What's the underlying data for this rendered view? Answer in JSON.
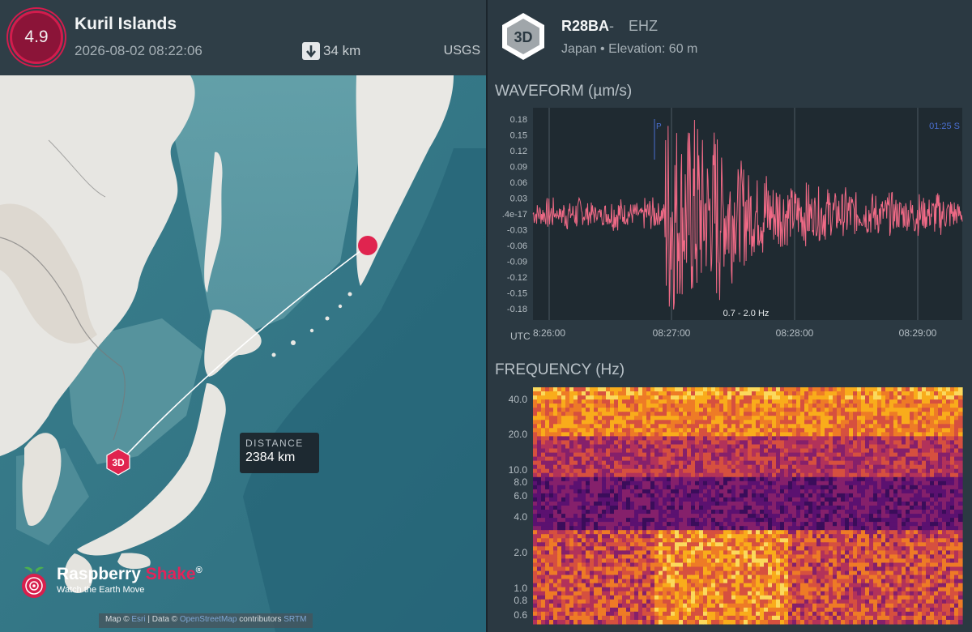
{
  "event": {
    "magnitude": "4.9",
    "title": "Kuril Islands",
    "datetime": "2026-08-02 08:22:06",
    "depth": "34 km",
    "depth_icon": "arrow-down-icon",
    "source": "USGS"
  },
  "map": {
    "distance_label": "DISTANCE",
    "distance_value": "2384 km",
    "station_marker": "3D",
    "epicenter_color": "#e0244f",
    "brand_name_1": "Raspberry ",
    "brand_name_2": "Shake",
    "brand_reg": "®",
    "brand_tagline": "Watch the Earth Move",
    "attribution_prefix": "Map © ",
    "attribution_link1": "Esri",
    "attribution_middle": " | Data © ",
    "attribution_link2": "OpenStreetMap",
    "attribution_suffix": " contributors ",
    "attribution_link3": "SRTM"
  },
  "station": {
    "badge": "3D",
    "name": "R28BA",
    "dash": "-",
    "channel": "EHZ",
    "location": "Japan • Elevation: 60 m"
  },
  "waveform": {
    "title": "WAVEFORM (µm/s)",
    "y_ticks": [
      "0.18",
      "0.15",
      "0.12",
      "0.09",
      "0.06",
      "0.03",
      ".4e-17",
      "-0.03",
      "-0.06",
      "-0.09",
      "-0.12",
      "-0.15",
      "-0.18"
    ],
    "x_ticks": [
      "8:26:00",
      "08:27:00",
      "08:28:00",
      "08:29:00"
    ],
    "utc_label": "UTC",
    "p_label": "P",
    "s_label": "01:25  S",
    "filter_label": "0.7 - 2.0 Hz",
    "trace_color": "#f06a86"
  },
  "frequency": {
    "title": "FREQUENCY (Hz)",
    "y_ticks": [
      "40.0",
      "20.0",
      "10.0",
      "8.0",
      "6.0",
      "4.0",
      "2.0",
      "1.0",
      "0.8",
      "0.6"
    ]
  },
  "chart_data": [
    {
      "type": "line",
      "title": "WAVEFORM (µm/s)",
      "xlabel": "UTC",
      "ylabel": "",
      "x_ticks": [
        "8:26:00",
        "08:27:00",
        "08:28:00",
        "08:29:00"
      ],
      "ylim": [
        -0.18,
        0.18
      ],
      "series": [
        {
          "values": [
            0.01,
            -0.01,
            0.02,
            0.0,
            -0.02,
            0.01,
            0.02,
            -0.01,
            0.01,
            0.0,
            0.01,
            -0.02,
            0.02,
            0.01,
            -0.01,
            0.0,
            0.02,
            -0.02,
            0.01,
            0.2,
            -0.18,
            0.15,
            -0.16,
            0.18,
            -0.14,
            0.12,
            -0.17,
            0.1,
            -0.12,
            0.08,
            -0.09,
            0.07,
            -0.06,
            0.08,
            -0.05,
            0.06,
            -0.05,
            0.04,
            -0.04,
            0.05,
            -0.03,
            0.04,
            -0.04,
            0.03,
            -0.03,
            0.04,
            -0.03,
            0.02,
            -0.03,
            0.03,
            -0.02,
            0.03,
            -0.02,
            0.02,
            -0.02,
            0.03,
            -0.02,
            0.02,
            -0.03,
            0.02,
            -0.02,
            0.01
          ]
        }
      ]
    },
    {
      "type": "heatmap",
      "title": "FREQUENCY (Hz)",
      "ylabel": "",
      "y_ticks": [
        "40.0",
        "20.0",
        "10.0",
        "8.0",
        "6.0",
        "4.0",
        "2.0",
        "1.0",
        "0.8",
        "0.6"
      ]
    }
  ]
}
